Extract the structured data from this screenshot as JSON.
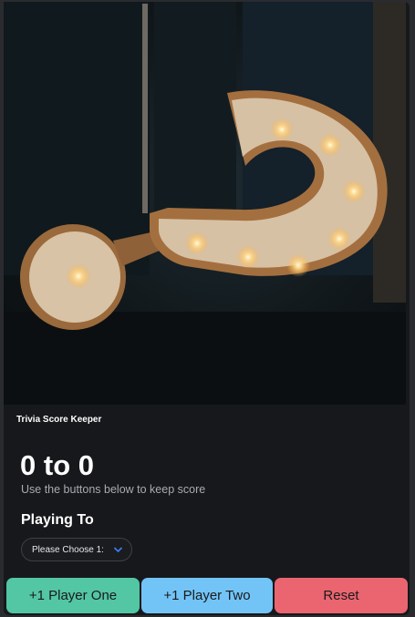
{
  "app": {
    "title": "Trivia Score Keeper"
  },
  "scoreboard": {
    "player_one": "0",
    "separator": "to",
    "player_two": "0",
    "hint": "Use the buttons below to keep score"
  },
  "playing_to": {
    "label": "Playing To",
    "selected": "Please Choose 1:"
  },
  "buttons": {
    "player_one": "+1 Player One",
    "player_two": "+1 Player Two",
    "reset": "Reset"
  },
  "colors": {
    "player_one": "#53c6a4",
    "player_two": "#72c4f7",
    "reset": "#ea6570"
  },
  "icons": {
    "select_chevron": "chevron-down-icon"
  }
}
